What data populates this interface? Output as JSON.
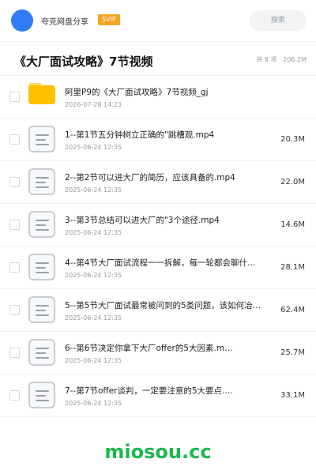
{
  "topbar": {
    "owner": "夸克网盘分享",
    "badge": "SVIP",
    "search_placeholder": "搜索"
  },
  "header": {
    "title": "《大厂面试攻略》7节视频",
    "meta": "共 8 项 · 206.2M"
  },
  "files": [
    {
      "type": "folder",
      "name": "阿里P9的《大厂面试攻略》7节视频_gj",
      "date": "2026-07-28 14:23",
      "size": ""
    },
    {
      "type": "video",
      "name": "1--第1节五分钟树立正确的\"跳槽观.mp4",
      "date": "2025-06-24 12:35",
      "size": "20.3M"
    },
    {
      "type": "video",
      "name": "2--第2节可以进大厂的简历，应该具备的.mp4",
      "date": "2025-06-24 12:35",
      "size": "22.0M"
    },
    {
      "type": "video",
      "name": "3--第3节总结可以进大厂的\"3个途径.mp4",
      "date": "2025-06-24 12:35",
      "size": "14.6M"
    },
    {
      "type": "video",
      "name": "4--第4节大厂面试流程一一拆解，每一轮都会聊什…",
      "date": "2025-06-24 12:35",
      "size": "28.1M"
    },
    {
      "type": "video",
      "name": "5--第5节大厂面试最常被问到的5类问题，该如何冶…",
      "date": "2025-06-24 12:35",
      "size": "62.4M"
    },
    {
      "type": "video",
      "name": "6--第6节决定你拿下大厂offer的5大因素.m…",
      "date": "2025-06-24 12:35",
      "size": "25.7M"
    },
    {
      "type": "video",
      "name": "7--第7节offer谈判，一定要注意的5大要点.…",
      "date": "2025-06-24 12:35",
      "size": "33.1M"
    }
  ],
  "watermark": "miosou.cc"
}
